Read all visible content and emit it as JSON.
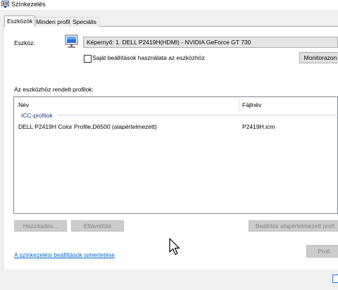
{
  "window": {
    "title": "Színkezelés"
  },
  "tabs": [
    {
      "label": "Eszközök",
      "active": true
    },
    {
      "label": "Minden profil",
      "active": false
    },
    {
      "label": "Speciális",
      "active": false
    }
  ],
  "device": {
    "label": "Eszköz:",
    "selected": "Képernyő: 1. DELL P2419H(HDMI) - NVIDIA GeForce GT 730",
    "checkbox_label": "Saját beállítások használata az eszközhöz",
    "checkbox_checked": false,
    "monitor_button": "Monitorazon"
  },
  "profiles": {
    "section_label": "Az eszközhöz rendelt profilok:",
    "columns": {
      "name": "Név",
      "file": "Fájlnév"
    },
    "group": "ICC-profilok",
    "rows": [
      {
        "name": "DELL P2419H Color Profile,D6500 (alapértelmezett)",
        "file": "P2419H.icm"
      }
    ]
  },
  "buttons": {
    "add": "Hozzáadás...",
    "remove": "Eltávolítás",
    "set_default": "Beállítás alapértelmezett profi",
    "profiles": "Profi"
  },
  "footer": {
    "link": "A színkezelési beállítások ismertetése"
  },
  "icons": {
    "title": "color-management-icon",
    "device": "monitor-icon",
    "cursor": "mouse-pointer-icon"
  }
}
